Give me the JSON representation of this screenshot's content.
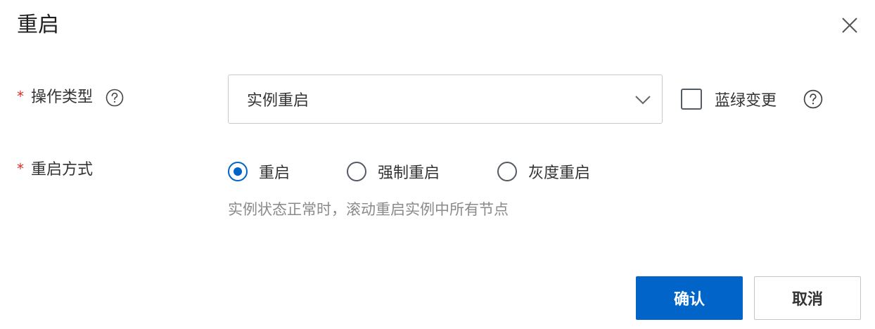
{
  "dialog": {
    "title": "重启",
    "close_icon": "close-icon"
  },
  "form": {
    "operation_type": {
      "required_mark": "*",
      "label": "操作类型",
      "help_icon": "help-icon",
      "select_value": "实例重启",
      "dropdown_icon": "chevron-down-icon"
    },
    "blue_green": {
      "label": "蓝绿变更",
      "checked": false,
      "help_icon": "help-icon"
    },
    "restart_method": {
      "required_mark": "*",
      "label": "重启方式",
      "options": [
        {
          "label": "重启",
          "checked": true
        },
        {
          "label": "强制重启",
          "checked": false
        },
        {
          "label": "灰度重启",
          "checked": false
        }
      ],
      "hint": "实例状态正常时，滚动重启实例中所有节点"
    }
  },
  "footer": {
    "confirm_label": "确认",
    "cancel_label": "取消"
  },
  "colors": {
    "primary": "#0064c8",
    "required": "#d93026",
    "hint": "#8a8a8a",
    "border": "#c9c9c9"
  }
}
